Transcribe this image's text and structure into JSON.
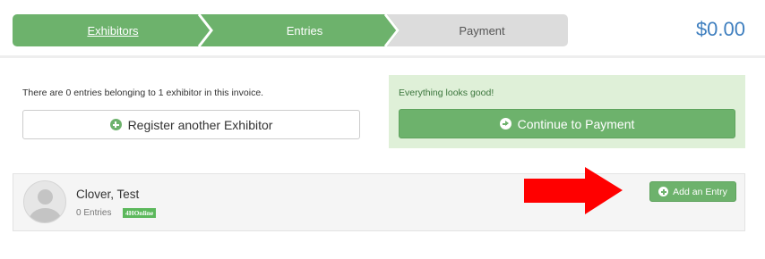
{
  "progress": {
    "steps": [
      {
        "label": "Exhibitors",
        "state": "done"
      },
      {
        "label": "Entries",
        "state": "current"
      },
      {
        "label": "Payment",
        "state": "pending"
      }
    ]
  },
  "invoice": {
    "total": "$0.00",
    "summary_text": "There are 0 entries belonging to 1 exhibitor in this invoice.",
    "register_button_label": "Register another Exhibitor",
    "success_message": "Everything looks good!",
    "continue_button_label": "Continue to Payment"
  },
  "exhibitor": {
    "name": "Clover, Test",
    "entries_label": "0 Entries",
    "badge": "4HOnline",
    "add_entry_label": "Add an Entry"
  },
  "colors": {
    "accent_green": "#6db26c",
    "pending_gray": "#dcdcdc",
    "total_blue": "#3f7fbf",
    "success_bg": "#dff0d8",
    "annotation_red": "#ff0000"
  },
  "icons": {
    "register": "plus-circle-icon",
    "continue": "arrow-circle-right-icon",
    "add_entry": "plus-circle-icon",
    "avatar": "user-placeholder-icon",
    "annotation": "red-arrow-icon"
  }
}
